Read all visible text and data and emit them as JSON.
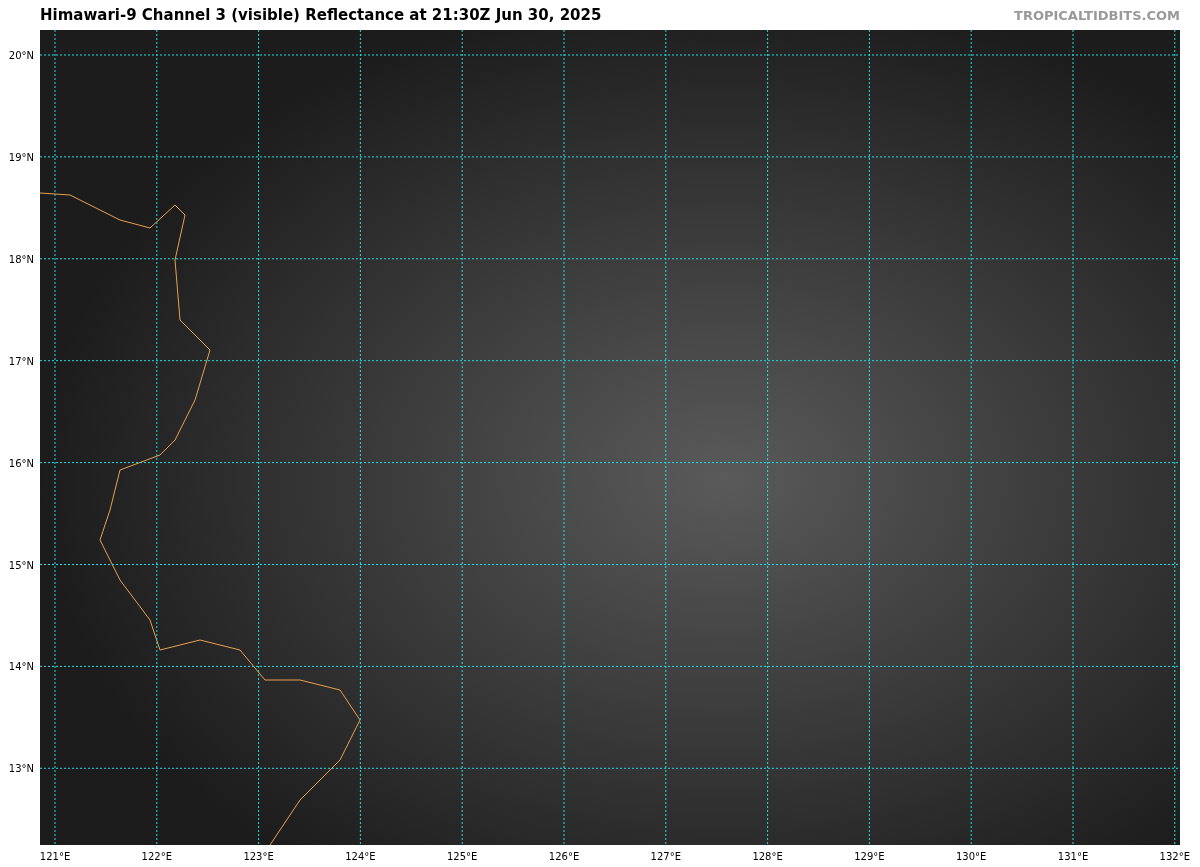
{
  "title": "Himawari-9 Channel 3 (visible) Reflectance at 21:30Z Jun 30, 2025",
  "credit": "TROPICALTIDBITS.COM",
  "map": {
    "lat_labels": [
      "20°N",
      "19°N",
      "18°N",
      "17°N",
      "16°N",
      "15°N",
      "14°N",
      "13°N"
    ],
    "lon_labels": [
      "121°E",
      "122°E",
      "123°E",
      "124°E",
      "125°E",
      "126°E",
      "127°E",
      "128°E",
      "129°E",
      "130°E",
      "131°E",
      "132°E"
    ]
  }
}
